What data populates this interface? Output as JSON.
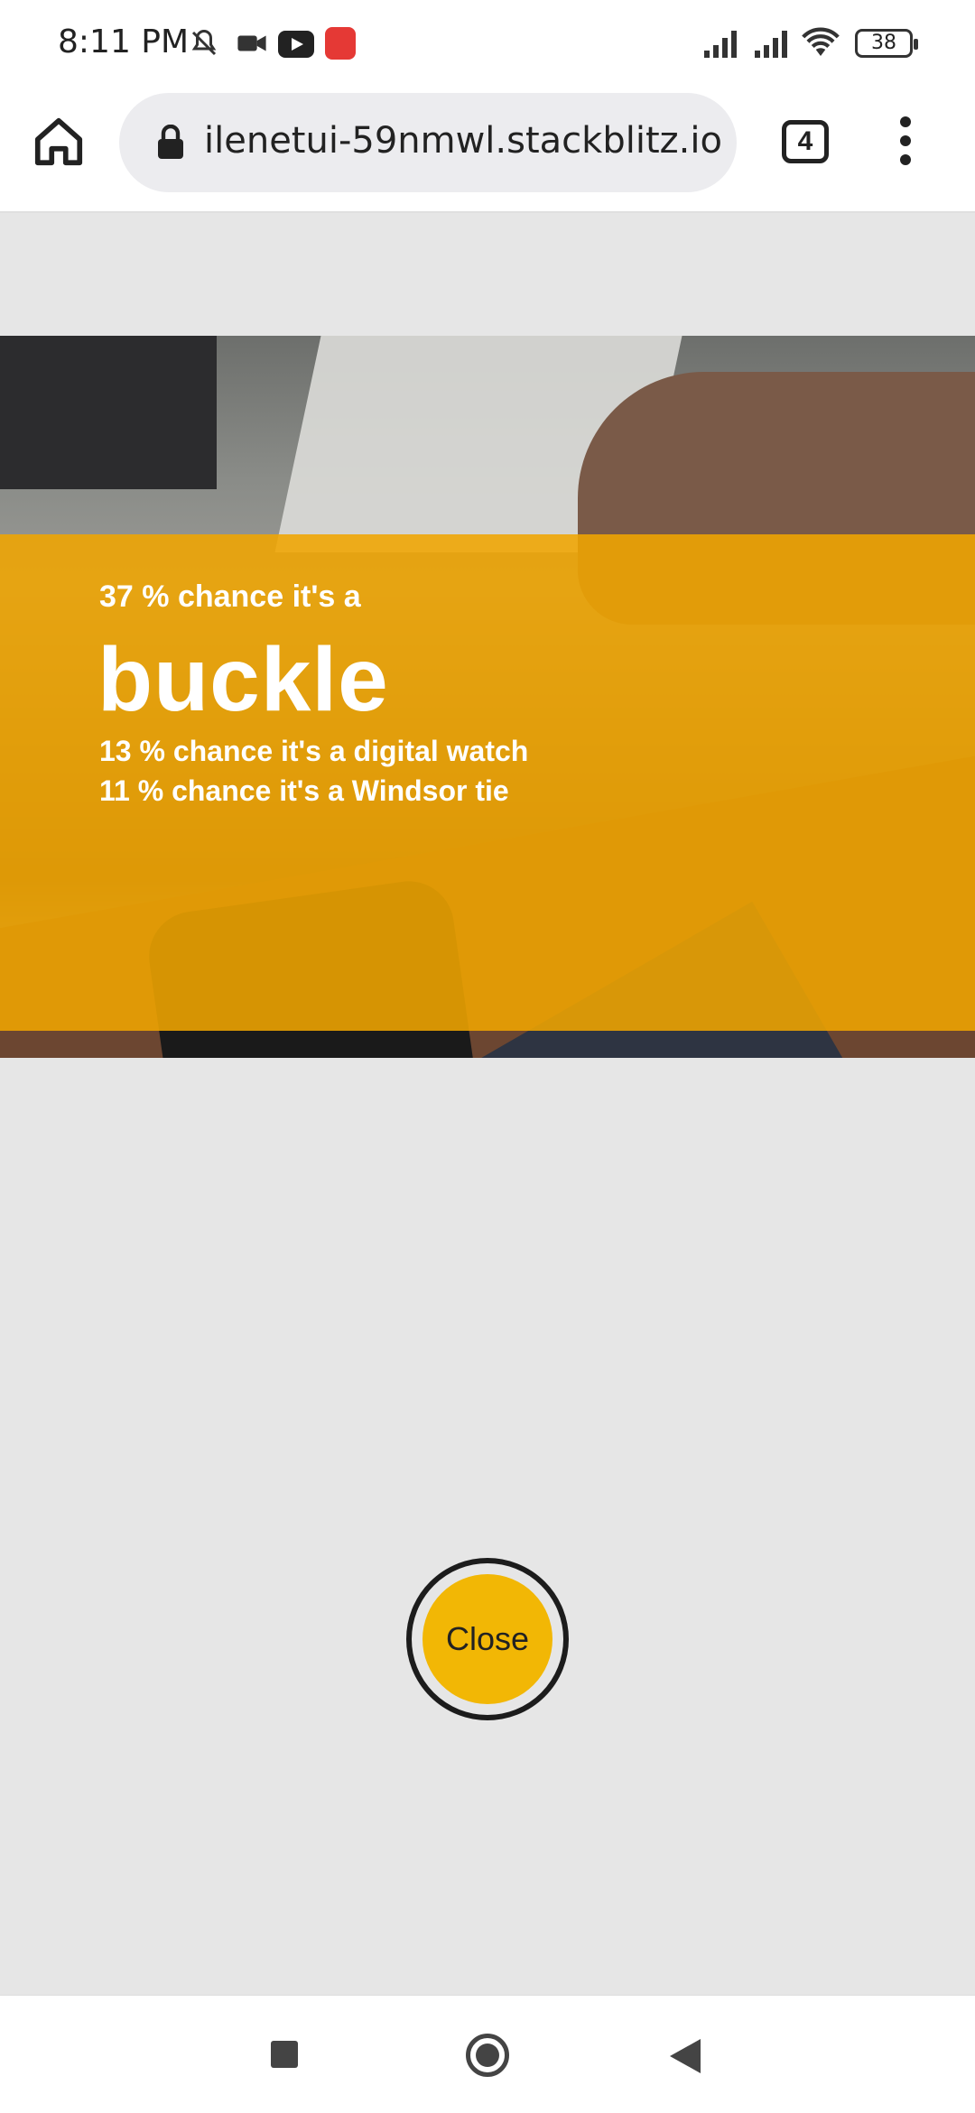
{
  "status_bar": {
    "time": "8:11 PM",
    "icons": [
      "muted-bell-icon",
      "video-camera-icon",
      "youtube-icon",
      "app-notification-icon",
      "signal-icon",
      "signal-icon",
      "wifi-icon"
    ],
    "battery_percent": "38"
  },
  "browser": {
    "url": "ilenetui-59nmwl.stackblitz.io",
    "tab_count": "4",
    "icons": [
      "home-icon",
      "lock-icon",
      "more-vert-icon"
    ]
  },
  "prediction": {
    "top_line": "37 % chance it's a",
    "top_label": "buckle",
    "other_lines": [
      "13 % chance it's a digital watch",
      "11 % chance it's a Windsor tie"
    ],
    "overlay_color": "#f0a500"
  },
  "close_button": {
    "label": "Close",
    "color": "#f2b705"
  },
  "nav_bar": {
    "icons": [
      "recents-square-icon",
      "home-circle-icon",
      "back-triangle-icon"
    ]
  }
}
